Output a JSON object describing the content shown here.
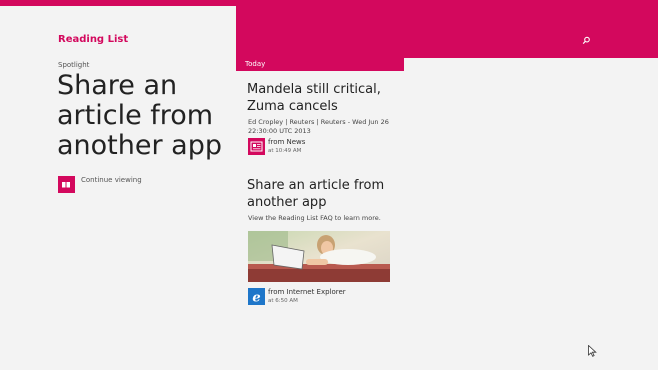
{
  "app": {
    "title": "Reading List"
  },
  "header": {
    "search_icon": "search-icon",
    "accent": "#d3085d"
  },
  "spotlight": {
    "label": "Spotlight",
    "title": "Share an article from another app",
    "continue_label": "Continue viewing",
    "continue_icon": "book-icon"
  },
  "today": {
    "label": "Today",
    "items": [
      {
        "title": "Mandela still critical, Zuma cancels",
        "meta": "Ed Cropley | Reuters | Reuters - Wed Jun 26 22:30:00 UTC 2013",
        "source": "from News",
        "time": "at 10:49 AM",
        "icon": "news-icon"
      },
      {
        "title": "Share an article from another app",
        "description": "View the Reading List FAQ to learn more.",
        "image": "woman-with-laptop-photo",
        "source": "from Internet Explorer",
        "time": "at 6:50 AM",
        "icon": "internet-explorer-icon"
      }
    ]
  }
}
